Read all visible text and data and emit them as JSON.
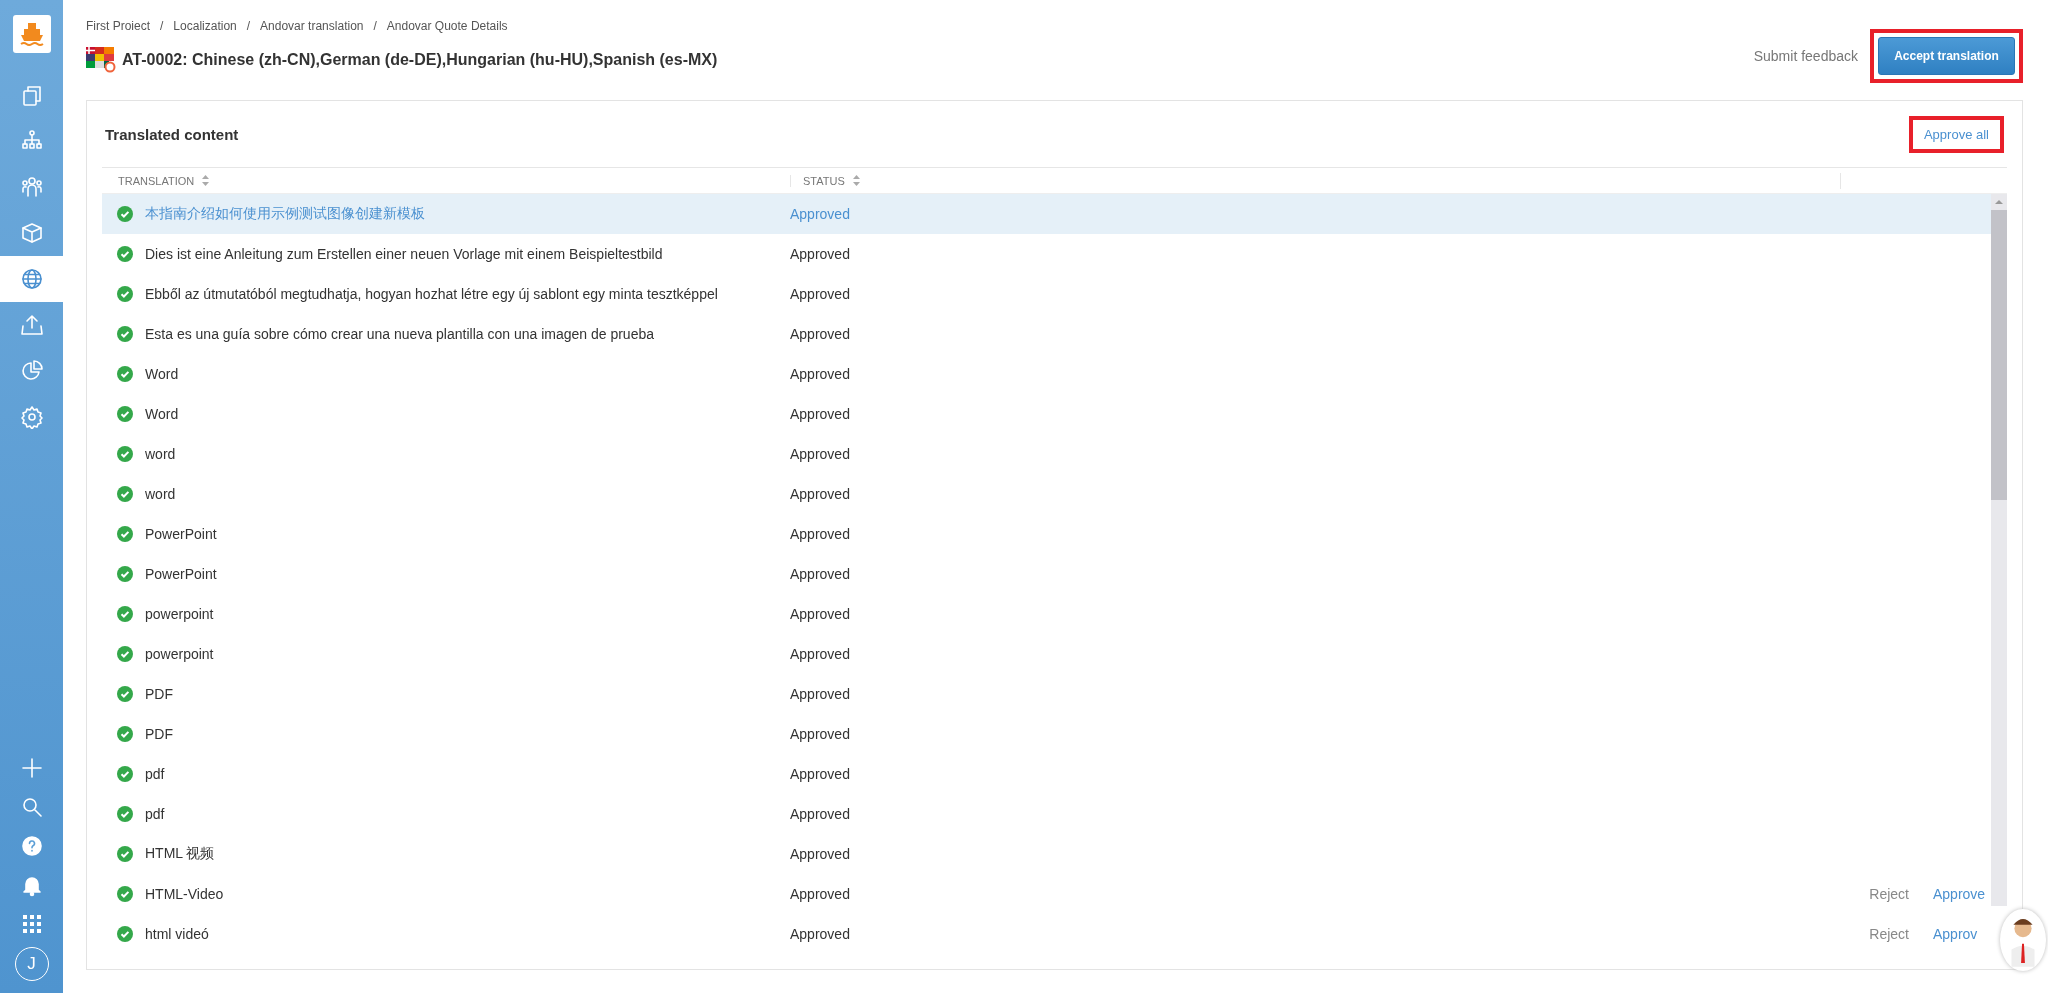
{
  "sidebar": {
    "items": [
      {
        "kind": "pages",
        "selected": false
      },
      {
        "kind": "hierarchy",
        "selected": false
      },
      {
        "kind": "people",
        "selected": false
      },
      {
        "kind": "box",
        "selected": false
      },
      {
        "kind": "globe",
        "selected": true
      },
      {
        "kind": "upload",
        "selected": false
      },
      {
        "kind": "pie",
        "selected": false
      },
      {
        "kind": "gear",
        "selected": false
      }
    ],
    "bottom": [
      {
        "kind": "plus"
      },
      {
        "kind": "search"
      },
      {
        "kind": "help"
      },
      {
        "kind": "bell"
      },
      {
        "kind": "apps"
      }
    ],
    "user_initial": "J"
  },
  "breadcrumb": [
    "First Proiect",
    "Localization",
    "Andovar translation",
    "Andovar Quote Details"
  ],
  "breadcrumb_separator": "/",
  "title": "AT-0002: Chinese (zh-CN),German (de-DE),Hungarian (hu-HU),Spanish (es-MX)",
  "submit_feedback": "Submit feedback",
  "accept_button": {
    "label": "Accept translation",
    "highlighted": true
  },
  "card": {
    "title": "Translated content",
    "approve_all": {
      "label": "Approve all",
      "highlighted": true
    }
  },
  "table": {
    "columns": [
      "TRANSLATION",
      "STATUS"
    ],
    "rows": [
      {
        "translation": "本指南介绍如何使用示例测试图像创建新模板",
        "status": "Approved",
        "selected": true
      },
      {
        "translation": "Dies ist eine Anleitung zum Erstellen einer neuen Vorlage mit einem Beispieltestbild",
        "status": "Approved",
        "selected": false
      },
      {
        "translation": "Ebből az útmutatóból megtudhatja, hogyan hozhat létre egy új sablont egy minta tesztképpel",
        "status": "Approved",
        "selected": false
      },
      {
        "translation": "Esta es una guía sobre cómo crear una nueva plantilla con una imagen de prueba",
        "status": "Approved",
        "selected": false
      },
      {
        "translation": "Word",
        "status": "Approved",
        "selected": false
      },
      {
        "translation": "Word",
        "status": "Approved",
        "selected": false
      },
      {
        "translation": "word",
        "status": "Approved",
        "selected": false
      },
      {
        "translation": "word",
        "status": "Approved",
        "selected": false
      },
      {
        "translation": "PowerPoint",
        "status": "Approved",
        "selected": false
      },
      {
        "translation": "PowerPoint",
        "status": "Approved",
        "selected": false
      },
      {
        "translation": "powerpoint",
        "status": "Approved",
        "selected": false
      },
      {
        "translation": "powerpoint",
        "status": "Approved",
        "selected": false
      },
      {
        "translation": "PDF",
        "status": "Approved",
        "selected": false
      },
      {
        "translation": "PDF",
        "status": "Approved",
        "selected": false
      },
      {
        "translation": "pdf",
        "status": "Approved",
        "selected": false
      },
      {
        "translation": "pdf",
        "status": "Approved",
        "selected": false
      },
      {
        "translation": "HTML 视频",
        "status": "Approved",
        "selected": false
      },
      {
        "translation": "HTML-Video",
        "status": "Approved",
        "selected": false,
        "actions": [
          "Reject",
          "Approve"
        ]
      },
      {
        "translation": "html videó",
        "status": "Approved",
        "selected": false,
        "actions": [
          "Reject",
          "Approv"
        ]
      }
    ]
  }
}
